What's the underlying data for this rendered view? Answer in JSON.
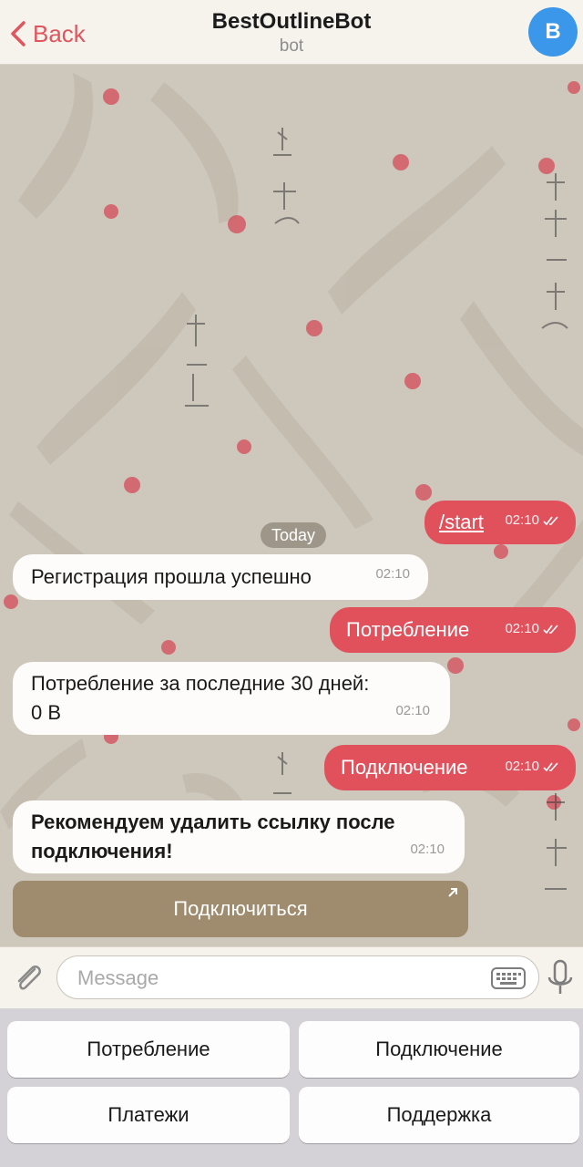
{
  "header": {
    "back_label": "Back",
    "title": "BestOutlineBot",
    "subtitle": "bot",
    "avatar_letter": "B"
  },
  "chat": {
    "date_label": "Today",
    "messages": [
      {
        "direction": "out",
        "text": "/start",
        "time": "02:10"
      },
      {
        "direction": "in",
        "text": "Регистрация прошла успешно",
        "time": "02:10"
      },
      {
        "direction": "out",
        "text": "Потребление",
        "time": "02:10"
      },
      {
        "direction": "in",
        "line1": "Потребление за последние 30 дней:",
        "line2": "0 B",
        "time": "02:10"
      },
      {
        "direction": "out",
        "text": "Подключение",
        "time": "02:10"
      },
      {
        "direction": "in",
        "line1": "Рекомендуем удалить ссылку после",
        "line2": "подключения!",
        "time": "02:10"
      }
    ],
    "inline_button_label": "Подключиться"
  },
  "composer": {
    "placeholder": "Message"
  },
  "keyboard": {
    "buttons": [
      "Потребление",
      "Подключение",
      "Платежи",
      "Поддержка"
    ]
  },
  "colors": {
    "accent": "#e0515c",
    "avatar": "#3a97ea",
    "inline_button": "#968060"
  },
  "icons": [
    "chevron-left-icon",
    "paperclip-icon",
    "keyboard-icon",
    "microphone-icon",
    "external-arrow-icon",
    "double-check-icon"
  ]
}
